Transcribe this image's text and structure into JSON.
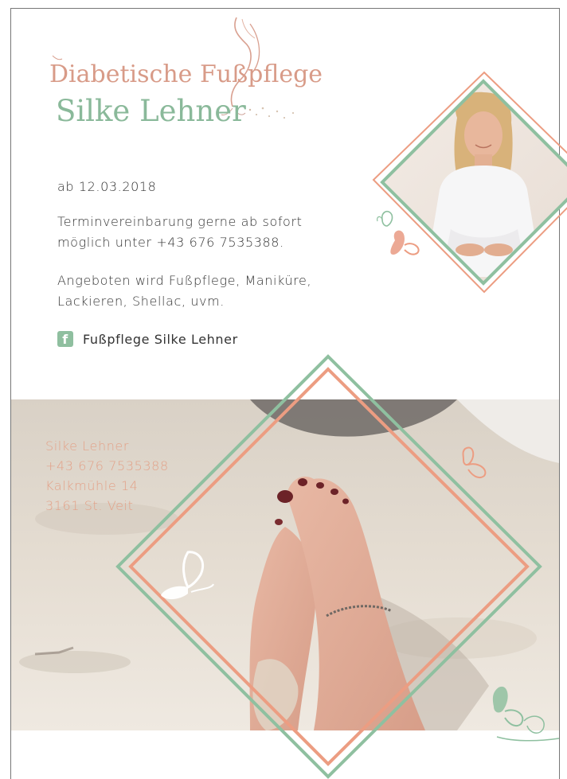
{
  "logo": {
    "line1": "Diabetische Fußpflege",
    "line2": "Silke Lehner"
  },
  "info": {
    "date": "ab 12.03.2018",
    "appointment": "Terminvereinbarung gerne ab sofort möglich unter +43 676 7535388.",
    "offer": "Angeboten wird Fußpflege, Maniküre, Lackieren, Shellac, uvm."
  },
  "facebook": {
    "icon": "facebook-icon",
    "label": "Fußpflege Silke Lehner"
  },
  "contact": {
    "name": "Silke Lehner",
    "phone": "+43 676 7535388",
    "street": "Kalkmühle 14",
    "city": "3161 St. Veit"
  },
  "colors": {
    "green": "#8fc0a0",
    "salmon": "#ec9d82"
  }
}
